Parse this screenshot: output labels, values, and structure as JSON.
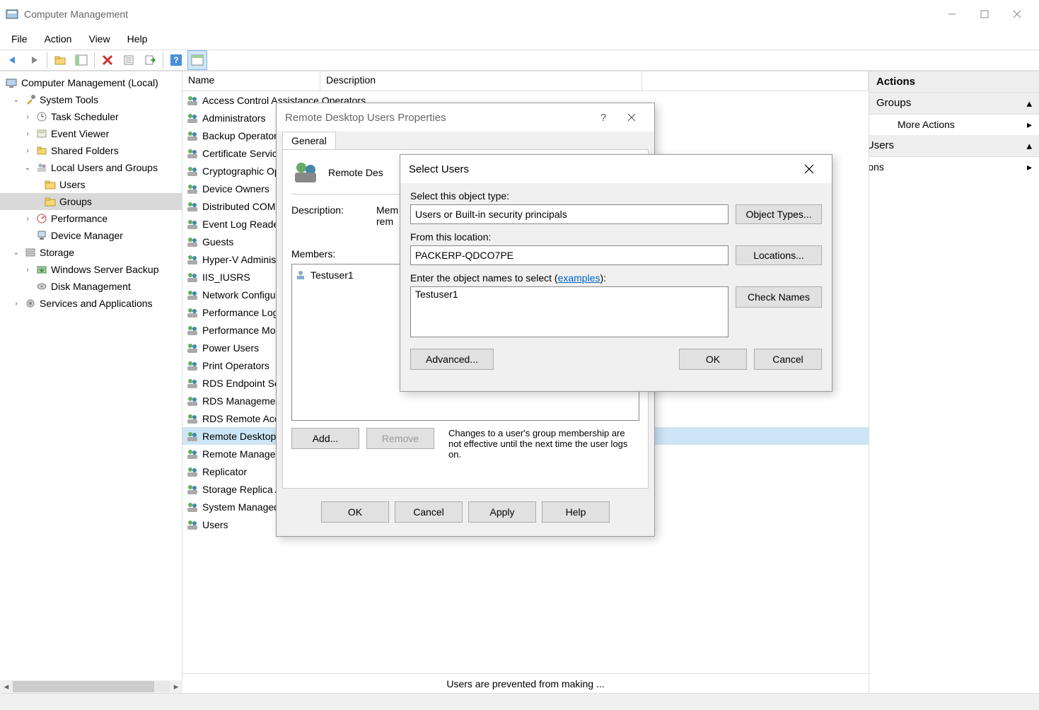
{
  "window": {
    "title": "Computer Management"
  },
  "menubar": [
    "File",
    "Action",
    "View",
    "Help"
  ],
  "tree": {
    "root": "Computer Management (Local)",
    "system_tools": "System Tools",
    "task_scheduler": "Task Scheduler",
    "event_viewer": "Event Viewer",
    "shared_folders": "Shared Folders",
    "local_users_groups": "Local Users and Groups",
    "users": "Users",
    "groups": "Groups",
    "performance": "Performance",
    "device_manager": "Device Manager",
    "storage": "Storage",
    "windows_server_backup": "Windows Server Backup",
    "disk_management": "Disk Management",
    "services_apps": "Services and Applications"
  },
  "list": {
    "col_name": "Name",
    "col_desc": "Description",
    "rows": [
      "Access Control Assistance Operators",
      "Administrators",
      "Backup Operators",
      "Certificate Service DCOM Access",
      "Cryptographic Operators",
      "Device Owners",
      "Distributed COM Users",
      "Event Log Readers",
      "Guests",
      "Hyper-V Administrators",
      "IIS_IUSRS",
      "Network Configuration Operators",
      "Performance Log Users",
      "Performance Monitor Users",
      "Power Users",
      "Print Operators",
      "RDS Endpoint Servers",
      "RDS Management Servers",
      "RDS Remote Access Servers",
      "Remote Desktop Users",
      "Remote Management Users",
      "Replicator",
      "Storage Replica Administrators",
      "System Managed Accounts Group",
      "Users"
    ],
    "selected_index": 19,
    "footer": "Users are prevented from making ..."
  },
  "actions": {
    "header": "Actions",
    "section1": "Groups",
    "item1": "More Actions",
    "section2_full": "Remote Desktop Users",
    "section2_visible": "p Users",
    "item2_full": "More Actions",
    "item2_visible": "ns"
  },
  "props_dialog": {
    "title": "Remote Desktop Users Properties",
    "tab": "General",
    "group_name_visible": "Remote Des",
    "group_name_full": "Remote Desktop Users",
    "description_label": "Description:",
    "description_visible": "Mem\nrem",
    "members_label": "Members:",
    "members": [
      "Testuser1"
    ],
    "add": "Add...",
    "remove": "Remove",
    "note": "Changes to a user's group membership are not effective until the next time the user logs on.",
    "ok": "OK",
    "cancel": "Cancel",
    "apply": "Apply",
    "help": "Help"
  },
  "select_dialog": {
    "title": "Select Users",
    "object_type_label": "Select this object type:",
    "object_type_value": "Users or Built-in security principals",
    "object_types_btn": "Object Types...",
    "location_label": "From this location:",
    "location_value": "PACKERP-QDCO7PE",
    "locations_btn": "Locations...",
    "names_label_pre": "Enter the object names to select (",
    "names_label_link": "examples",
    "names_label_post": "):",
    "names_value": "Testuser1",
    "check_names": "Check Names",
    "advanced": "Advanced...",
    "ok": "OK",
    "cancel": "Cancel"
  }
}
